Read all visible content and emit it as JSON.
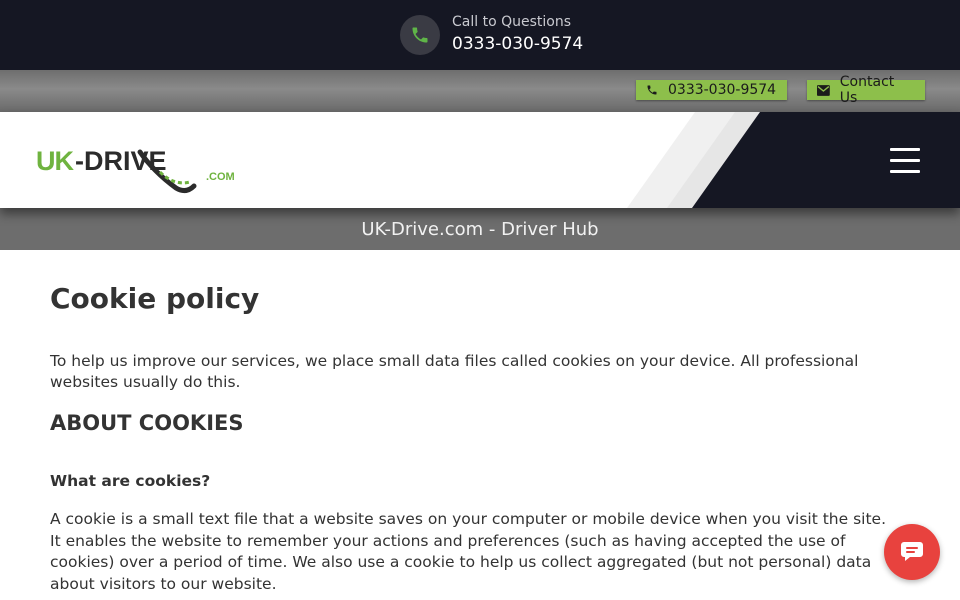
{
  "topbar": {
    "call_label": "Call to Questions",
    "call_number": "0333-030-9574",
    "phone_icon": "phone-icon"
  },
  "contact_strip": {
    "phone_label": "0333-030-9574",
    "contact_label": "Contact Us",
    "pill_color": "#8dbf4b"
  },
  "header": {
    "logo_text": "UK-DRIVE",
    "logo_suffix": ".COM",
    "menu_icon": "hamburger-menu-icon"
  },
  "band": {
    "title": "UK-Drive.com - Driver Hub"
  },
  "main": {
    "title": "Cookie policy",
    "intro": "To help us improve our services, we place small data files called cookies on your device. All professional websites usually do this.",
    "section_heading": "ABOUT COOKIES",
    "subheading": "What are cookies?",
    "paragraph": "A cookie is a small text file that a website saves on your computer or mobile device when you visit the site. It enables the website to remember your actions and preferences (such as having accepted the use of cookies) over a period of time. We also use a cookie to help us collect aggregated (but not personal) data about visitors to our website."
  },
  "chat": {
    "icon": "chat-icon",
    "color": "#e8423e"
  },
  "colors": {
    "dark": "#151723",
    "brand_green": "#6fb33f"
  }
}
